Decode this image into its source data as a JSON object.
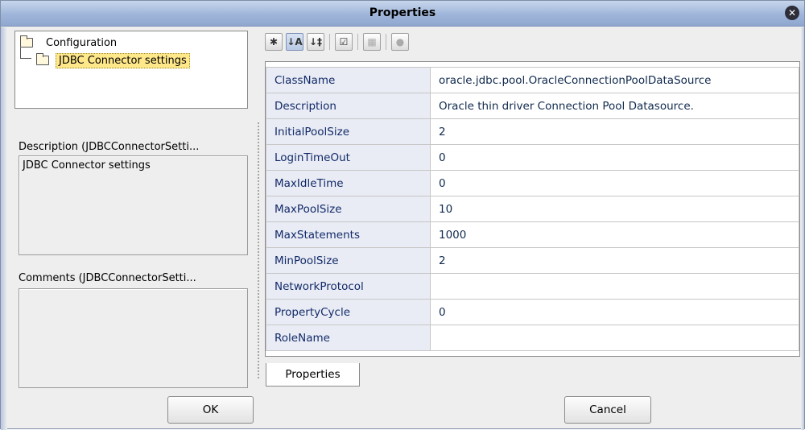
{
  "window": {
    "title": "Properties"
  },
  "tree": {
    "root_label": "Configuration",
    "child_label": "JDBC Connector settings"
  },
  "description": {
    "label": "Description (JDBCConnectorSetti...",
    "value": "JDBC Connector settings"
  },
  "comments": {
    "label": "Comments (JDBCConnectorSetti...",
    "value": ""
  },
  "toolbar": {
    "buttons": [
      {
        "icon": "expand-all-icon",
        "glyph": "✱"
      },
      {
        "icon": "sort-alphabetical-icon",
        "glyph": "↓A"
      },
      {
        "icon": "sort-category-icon",
        "glyph": "↓‡"
      },
      {
        "icon": "checklist-icon",
        "glyph": "☑"
      },
      {
        "icon": "grid-icon",
        "glyph": "▦"
      },
      {
        "icon": "help-icon",
        "glyph": "●"
      }
    ]
  },
  "properties": [
    {
      "name": "ClassName",
      "value": "oracle.jdbc.pool.OracleConnectionPoolDataSource"
    },
    {
      "name": "Description",
      "value": "Oracle thin driver Connection Pool Datasource."
    },
    {
      "name": "InitialPoolSize",
      "value": "2"
    },
    {
      "name": "LoginTimeOut",
      "value": "0"
    },
    {
      "name": "MaxIdleTime",
      "value": "0"
    },
    {
      "name": "MaxPoolSize",
      "value": "10"
    },
    {
      "name": "MaxStatements",
      "value": "1000"
    },
    {
      "name": "MinPoolSize",
      "value": "2"
    },
    {
      "name": "NetworkProtocol",
      "value": ""
    },
    {
      "name": "PropertyCycle",
      "value": "0"
    },
    {
      "name": "RoleName",
      "value": ""
    }
  ],
  "tab": {
    "label": "Properties"
  },
  "buttons": {
    "ok": "OK",
    "cancel": "Cancel"
  }
}
